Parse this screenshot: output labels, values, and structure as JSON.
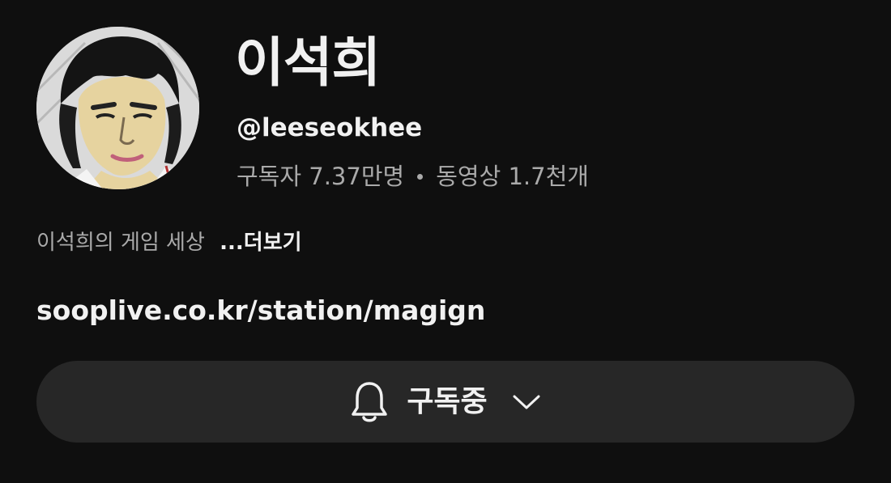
{
  "channel": {
    "name": "이석희",
    "handle": "@leeseokhee",
    "subscribers": "구독자 7.37만명",
    "videos": "동영상 1.7천개",
    "description": "이석희의 게임 세상",
    "more_label": "...더보기",
    "link": "sooplive.co.kr/station/magign"
  },
  "subscribe_button": {
    "label": "구독중",
    "icon": "bell-icon",
    "chevron_icon": "chevron-down-icon"
  },
  "colors": {
    "background": "#0f0f0f",
    "button_bg": "#272727",
    "primary_text": "#f1f1f1",
    "secondary_text": "#aaaaaa"
  }
}
